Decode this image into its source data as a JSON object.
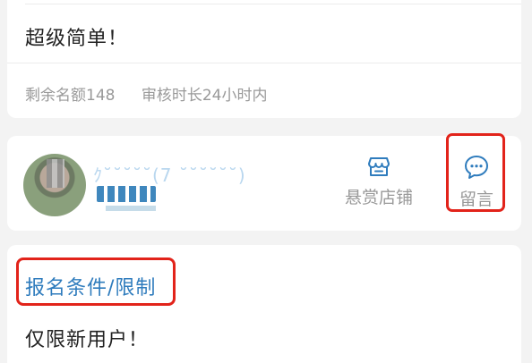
{
  "task_card": {
    "title": "超级简单！",
    "remaining_quota": "剩余名额148",
    "review_time": "审核时长24小时内"
  },
  "shop_card": {
    "user_name_masked": "ｸ˘˘˘˘˘(7 ˘˘˘˘˘˘)",
    "shop_button_label": "悬赏店铺",
    "message_button_label": "留言"
  },
  "conditions_card": {
    "title": "报名条件/限制",
    "content": "仅限新用户！"
  },
  "colors": {
    "accent_blue": "#2f7cbd",
    "highlight_red": "#e2231a",
    "muted_gray": "#999999"
  },
  "icons": {
    "shop": "store-icon",
    "message": "chat-bubble-icon"
  }
}
